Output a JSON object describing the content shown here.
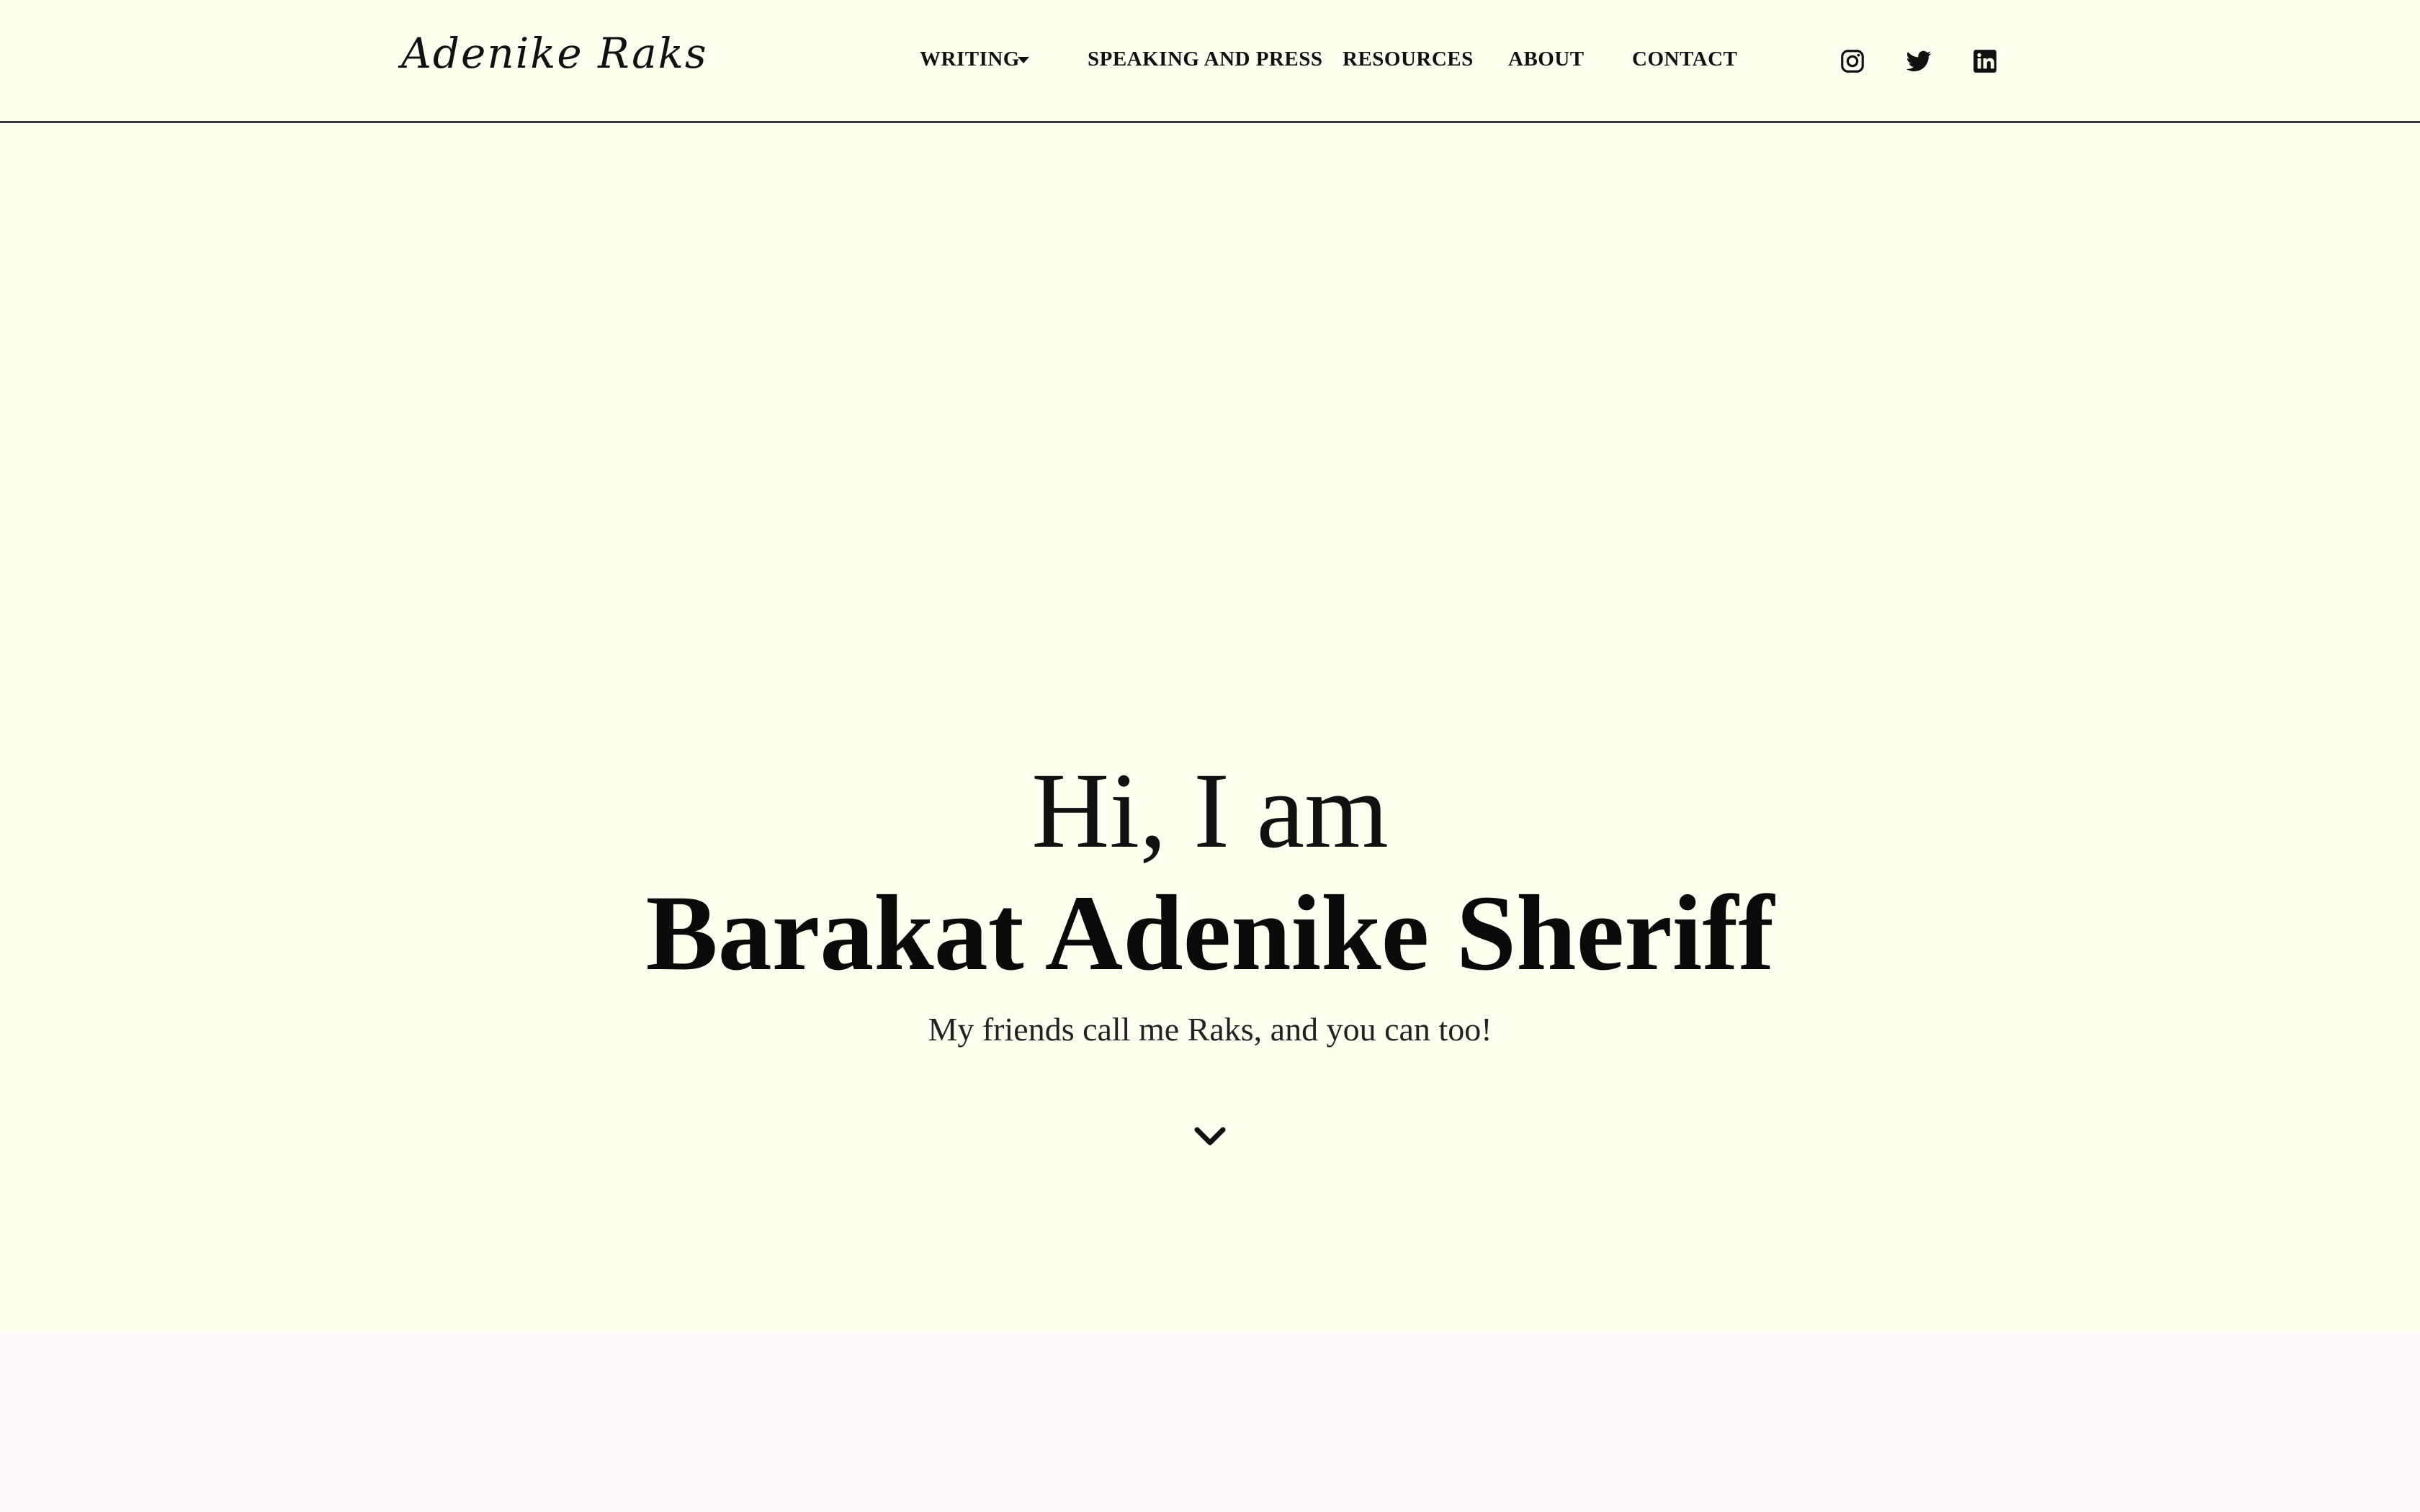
{
  "header": {
    "logo_text": "Adenike Raks",
    "nav": {
      "writing": "WRITING",
      "speaking": "SPEAKING AND PRESS",
      "resources": "RESOURCES",
      "about": "ABOUT",
      "contact": "CONTACT"
    },
    "social_icons": [
      "instagram-icon",
      "twitter-icon",
      "linkedin-icon"
    ]
  },
  "hero": {
    "greeting": "Hi, I am",
    "name": "Barakat Adenike Sheriff",
    "subtitle": "My friends call me Raks, and you can too!",
    "scroll_icon": "chevron-down-icon"
  },
  "colors": {
    "background": "#FEFFEF",
    "next_section_background": "#FFF8FA",
    "text": "#0d0d0d",
    "header_border": "#3a3a3a"
  }
}
